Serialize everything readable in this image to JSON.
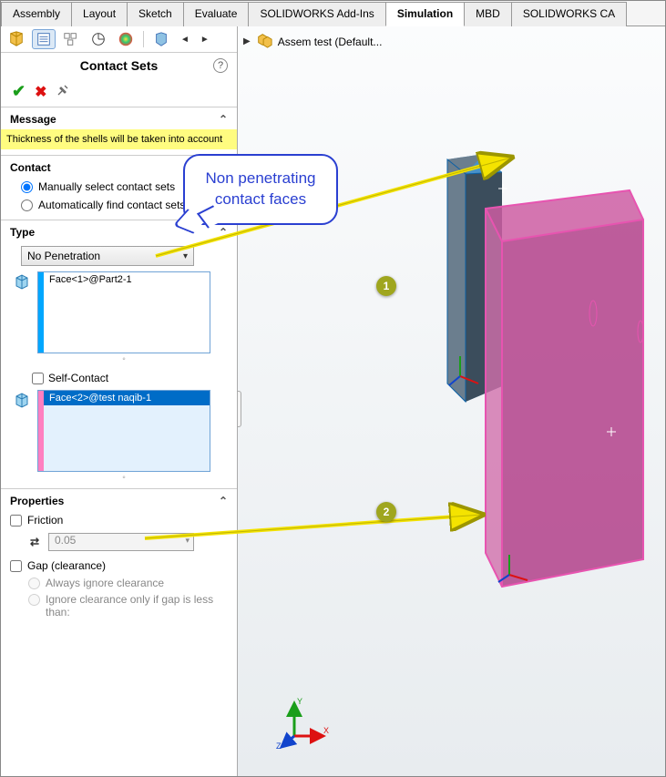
{
  "tabs": {
    "t0": "Assembly",
    "t1": "Layout",
    "t2": "Sketch",
    "t3": "Evaluate",
    "t4": "SOLIDWORKS Add-Ins",
    "t5": "Simulation",
    "t6": "MBD",
    "t7": "SOLIDWORKS CA"
  },
  "panel": {
    "title": "Contact Sets"
  },
  "message": {
    "label": "Message",
    "body": "Thickness of the shells will be taken into account"
  },
  "contact": {
    "label": "Contact",
    "opt_manual": "Manually select contact sets",
    "opt_auto": "Automatically find contact sets"
  },
  "type": {
    "label": "Type",
    "combo": "No Penetration",
    "face1": "Face<1>@Part2-1",
    "self_contact": "Self-Contact",
    "face2": "Face<2>@test naqib-1"
  },
  "properties": {
    "label": "Properties",
    "friction": "Friction",
    "friction_value": "0.05",
    "gap": "Gap (clearance)",
    "gap_opt1": "Always ignore clearance",
    "gap_opt2": "Ignore clearance only if gap is less than:"
  },
  "viewport": {
    "header": "Assem test  (Default..."
  },
  "callout": {
    "text": "Non penetrating contact faces"
  },
  "badges": {
    "b1": "1",
    "b2": "2"
  },
  "icons": {
    "help": "?"
  }
}
